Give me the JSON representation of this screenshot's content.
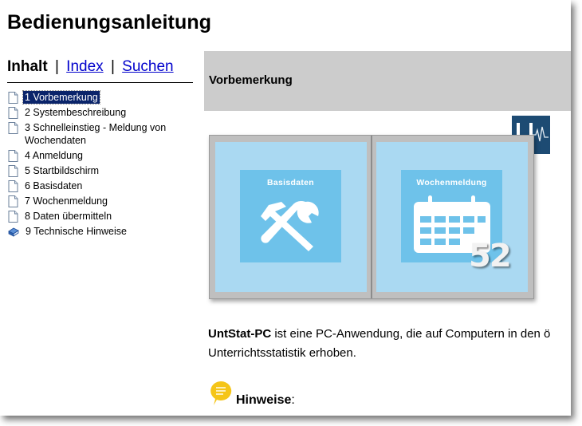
{
  "header": {
    "title": "Bedienungsanleitung"
  },
  "nav": {
    "active_tab": "Inhalt",
    "separator": "|",
    "index_link": "Index",
    "search_link": "Suchen"
  },
  "toc": {
    "items": [
      {
        "label": "1 Vorbemerkung",
        "icon": "page-icon",
        "selected": true
      },
      {
        "label": "2 Systembeschreibung",
        "icon": "page-icon"
      },
      {
        "label": "3 Schnelleinstieg - Meldung von Wochendaten",
        "icon": "page-icon"
      },
      {
        "label": "4 Anmeldung",
        "icon": "page-icon"
      },
      {
        "label": "5 Startbildschirm",
        "icon": "page-icon"
      },
      {
        "label": "6 Basisdaten",
        "icon": "page-icon"
      },
      {
        "label": "7 Wochenmeldung",
        "icon": "page-icon"
      },
      {
        "label": "8 Daten übermitteln",
        "icon": "page-icon"
      },
      {
        "label": "9 Technische Hinweise",
        "icon": "book-icon"
      }
    ]
  },
  "content": {
    "heading": "Vorbemerkung",
    "logo_icon": "u-logo-icon",
    "tiles": [
      {
        "title": "Basisdaten",
        "icon": "tools-icon"
      },
      {
        "title": "Wochenmeldung",
        "icon": "calendar-icon",
        "badge": "52"
      }
    ],
    "intro_bold": "UntStat-PC",
    "intro_line1": " ist eine PC-Anwendung, die auf Computern in den ö",
    "intro_line2": "Unterrichtsstatistik erhoben.",
    "hint_label": "Hinweise",
    "hint_colon": ":"
  },
  "colors": {
    "heading_band": "#cccccc",
    "selected_bg": "#0a246a",
    "tile_bg": "#aad9f2",
    "tile_inner": "#6ec2ea",
    "link": "#0000cc",
    "logo_bg": "#1d4b73",
    "hint_icon": "#f5c518"
  }
}
